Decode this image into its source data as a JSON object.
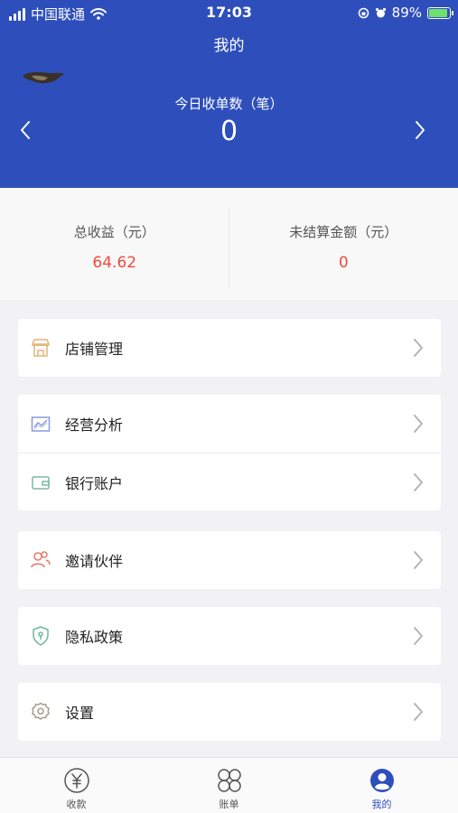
{
  "status_bar": {
    "carrier": "中国联通",
    "time": "17:03",
    "battery": "89%",
    "battery_level": 0.89
  },
  "header": {
    "title": "我的",
    "orders_label": "今日收单数（笔）",
    "orders_value": "0"
  },
  "summary": {
    "total_income_label": "总收益（元）",
    "total_income_value": "64.62",
    "unsettled_label": "未结算金额（元）",
    "unsettled_value": "0"
  },
  "menu": {
    "store": "店铺管理",
    "analysis": "经营分析",
    "bank": "银行账户",
    "invite": "邀请伙伴",
    "privacy": "隐私政策",
    "settings": "设置"
  },
  "tabs": {
    "collect": "收款",
    "bills": "账单",
    "mine": "我的"
  },
  "colors": {
    "primary": "#2e4fbb",
    "accent_red": "#f04a3a"
  },
  "icons": [
    "wifi-icon",
    "alarm-icon",
    "lock-rotation-icon",
    "battery-icon",
    "store-icon",
    "chart-icon",
    "wallet-icon",
    "people-icon",
    "shield-icon",
    "gear-icon",
    "yen-icon",
    "grid-icon",
    "user-icon"
  ]
}
